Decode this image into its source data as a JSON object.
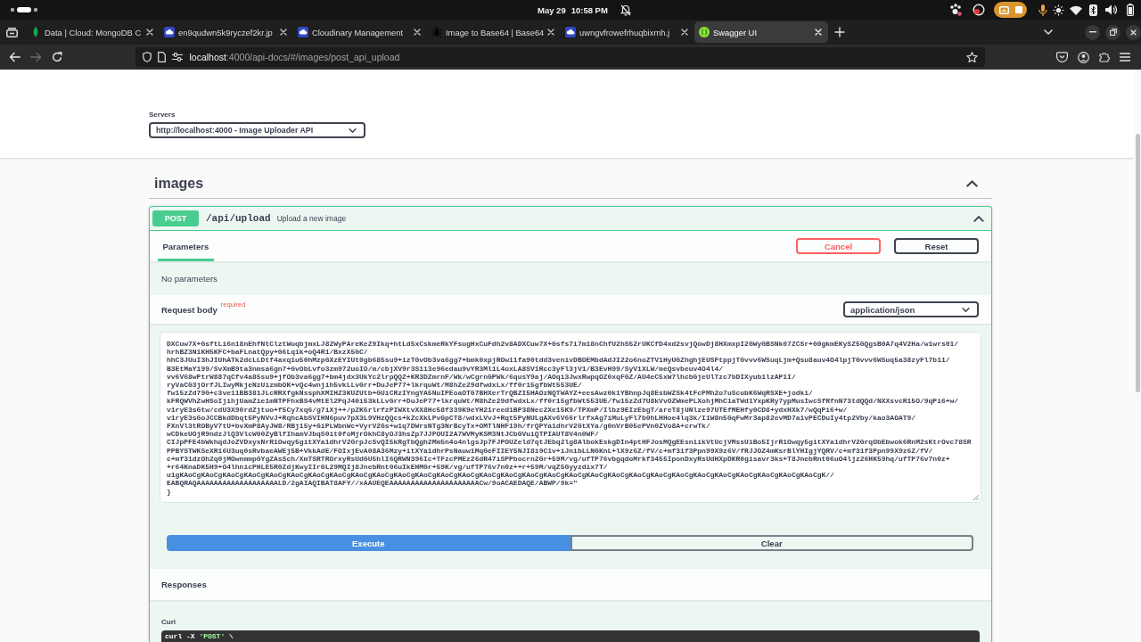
{
  "system_bar": {
    "date": "May 29",
    "time": "10:58 PM"
  },
  "browser": {
    "tabs": [
      {
        "title": "Data | Cloud: MongoDB C",
        "kind": "leaf",
        "selected": false
      },
      {
        "title": "en9qudwn5k9ryczef2kr.jp",
        "kind": "cloud",
        "selected": false
      },
      {
        "title": "Cloudinary Management",
        "kind": "cloud",
        "selected": false
      },
      {
        "title": "Image to Base64 | Base64",
        "kind": "bug",
        "selected": false
      },
      {
        "title": "uwngvfrowefrhuqbixmh.j",
        "kind": "cloud",
        "selected": false
      },
      {
        "title": "Swagger UI",
        "kind": "swagger",
        "selected": true
      }
    ],
    "forward_disabled": true,
    "address": {
      "host": "localhost",
      "rest": ":4000/api-docs/#/images/post_api_upload"
    }
  },
  "servers": {
    "label": "Servers",
    "value": "http://localhost:4000 - Image Uploader API"
  },
  "tag": {
    "name": "images",
    "expanded": true
  },
  "operation": {
    "method": "POST",
    "path": "/api/upload",
    "summary": "Upload a new image",
    "expanded": true,
    "section_tabs": [
      {
        "label": "Parameters",
        "selected": true
      }
    ],
    "buttons": [
      {
        "label": "Cancel",
        "kind": "cancel"
      },
      {
        "label": "Reset",
        "kind": "reset"
      }
    ],
    "parameters_note": "No parameters",
    "request_body": {
      "title": "Request body",
      "required_label": "required",
      "content_type": "application/json",
      "lines": [
        "DXCuw7X+GsftLi6n18nEhfNtClztWuqbjmxLJ82WyPAreKeZ9Ikq+htLd5xCskmeRkYFsugHxCuFdh2v8ADXCuw7X+Gsfs7i7m18nChfU2hS52rUKCfD4xd2svjQowDj8HXmxpI2GWyGBSNk07ZCSr+G0gkmEKySZ5GQgsB0A7q4V2Ha/w1wrs01/",
        "hrhBZ3N1KH5KFC+baFLnatQpy+G6Lq1k+oQ4R1/BxzX5GC/",
        "hhC3JUuI3hJIUhATk2dcLLDtf4axq1u50hMzpGXzEYIUt0gb685su9+izTGvOb3va6gg7+bmk0xpjROw11fa90tdd3venivDBOEMbdAdJI22o6noZTV1HyUGZhghjEUSFtppjTGvvv6WSuqLjm+Qsu8auv4O4lpjTGvvv6WSuq5a38zyFl7b11/",
        "B3EtMaY199/SvXmB9ta3nmsa6gn7+GvObLvfo3zm972uoIO/m/cbjXV9r3S113e96edau9vYR3Ml1L4oxLA8SV1Rcc3yFl3jV1/B3EvH99/SyV1XLW/meQsvbeuv4O4l4/",
        "vv6V68wPtrW887qCfv4a85su9+jfOb3va6gg7+bm4jdx3UkYc2lrpQQZ+KR3DZmrnF/Wk/wCgrnGPWk/6qusY9aj/AOqi3JwxRwpqOZ0xqFGZ/AU4eC5xW7lhcbGjeUlTzc7bDIXyub1lzAP1I/",
        "ryVaCG3jOrfJLIwyMkjeNzUizmbOK+vQc4wnjih5vkLLvGrr+DuJeP77+lkrquWt/M8hZe29dfwdxLx/ff0r15gfbWt553UE/",
        "fw15zZd79G+c3ve11BB381JLcRRXfgkNssphXMIHZ3KUZUtb+GUiCRzIYngYA5NuIPEoaOTG7BHXerTrQBZI5HAOzNQTWAYZ+eesAwz0k1YBhnpJq8EsbWZSk4tFcPMh2o7uScubK6WqRSXE+jodki/",
        "kFRQWVhZwHSoIjihjUamZie1mNTPFhxBS4vMtEl2PqJ40i53kLLvGrr+DuJeP77+lkrquWt/M8hZe29dfwdxLx/ff0r15gfbWt553UE/fw15zZd7U8kVvOZWmePLXohjMhC1aTWd1YxpKRy7ypMusIwcSfRfnN73tdQQd/NXXsvcR15O/9qPi6+w/",
        "v1ryE3sGtw/cdU3X90rdZjtuo+f5Cy7xq6/g7iXj++/pZK6rlrfzPIWXtvXX8Hc58f339K9eYH21reed1BP38Nec2Xe15K9/TPXmP/Ilbz9EIzEbgT/areT8jUNlze97UTEfMEHfy0CD8+ydxHXk7/wQqPi6+w/",
        "v1ryE3sGoJCCBkdDbqt5PyNVvJ+RqhcAbSVIHN6puv7pX3L9VHzQQcs+kZcXkLPvGpCT8/wdxLVvJ+Rqt5PyNULgAXv6V66rlrfxAg7iMuLyFl7b0hLHHoe4lq3k/I1W8n5GqFwMr3ap82evMD7a1vPECDuIy4tp2Vby/kao3AOAT9/",
        "FXnVl3tROByV7tU+bvXmP8AyJW8/RBj15y+GiPLWbnWc+VyrV2Gs+w1q7DWrsNTg3NrBcyTx+OMTlNHF19h/frQPYa1dhrV2GtXYa/g0nVrB05ePVn0ZVo8A+crwTk/",
        "wCDkeUOjR9ndzJlQ3VlcW00ZyBlfIhamVJbqS0it0foMjrOkhC8yOJ3hsZp7JJPOUI2A7WVMyKSM3NtJCbGVuiQTPIAUT8V4n0WF/",
        "CIJpPFE4bWkhqdJoZVDxyxNrR1Owqy5gitXYa1dhrV2GrpJcSvQI5kRgTbQgh2Mm5n4o4nlgsJp7FJPOUZeld7qtJEbq2lg8AlbokEskgDIn4ptHFJosMQgEEsniikVtUcjVMssUiBo5IjrR1Owqy5gitXYa1dhrV2GrqObEbwok6RnM2sKtrOvc78SR",
        "PPBYSTWKSeXR16U3uq0sRvbaeAWEj5B+VkkAdE/FOIxjEvA08A36Mzy+itXYa1dhrPsNauw1MqGeFIIEY5NJI8i9C1v+iJnibLLNGKnL+lX9z6Z/fV/c+mf31f3Ppn99X9z6V/fRJJOZ4mKsrBlYHIgjYQRV/c+mf31f3Ppn99X9z6Z/fV/",
        "c+mf31dzOh2q0jMOwnmmpGYgZAsSch/XmTSRTROrxyRsUdGU5hlI6QRWN396Ic+TFzcPMEz26dR47iSPPbocrn2Gr+59M/vg/ufTP76vbgqdoMrkf3455IponDxyRsUdHXpDKR0gisavr3ks+T8JnebRnt06uO4ljz26HK59hq/ufTP76v7n0z+",
        "+r64KnaDK5H9+O4lhnicPHLE5R0ZdjKwyIIrGL29MQIj8JnebRnt06uIkEHMGr+59K/vg/ufTP76v7n0z++r+59M/vqZ5Gyyzdix7T/",
        "u1gKAoCgKAoCgKAoCgKAoCgKAoCgKAoCgKAoCgKAoCgKAoCgKAoCgKAoCgKAoCgKAoCgKAoCgKAoCgKAoCgKAoCgKAoCgKAoCgKAoCgKAoCgKAoCgKAoCgKAoCgKAoCgKAoCgKAoCgKAoCgKAoCgKAoCgK//",
        "EABQRAQAAAAAAAAAAAAAAAAAAALD/2gAIAQIBAT8AFY//xAAUEQEAAAAAAAAAAAAAAAAAAAAACw/9oACAEDAQE/ABWP/9k=\"",
        "}"
      ]
    },
    "actions": [
      {
        "label": "Execute",
        "kind": "execute"
      },
      {
        "label": "Clear",
        "kind": "clear"
      }
    ],
    "responses": {
      "title": "Responses",
      "curl_label": "Curl",
      "curl_lines": [
        [
          {
            "text": "curl -X ",
            "kind": "plain"
          },
          {
            "text": "'POST'",
            "kind": "string"
          },
          {
            "text": " \\",
            "kind": "plain"
          }
        ]
      ]
    }
  }
}
